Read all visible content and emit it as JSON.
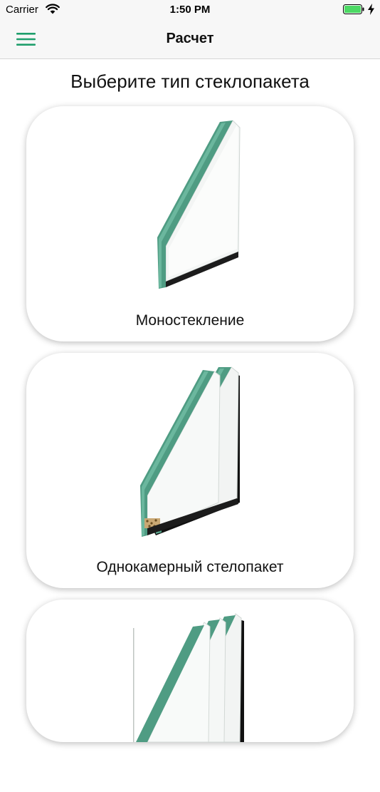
{
  "status_bar": {
    "carrier": "Carrier",
    "time": "1:50 PM",
    "battery_color": "#4cd964"
  },
  "nav": {
    "title": "Расчет",
    "menu_icon": "hamburger-menu-icon",
    "accent_color": "#1f9e6c"
  },
  "heading": "Выберите тип стеклопакета",
  "options": [
    {
      "label": "Моностекление",
      "glass_panes": 1
    },
    {
      "label": "Однокамерный стелопакет",
      "glass_panes": 2
    },
    {
      "label": "",
      "glass_panes": 3
    }
  ]
}
